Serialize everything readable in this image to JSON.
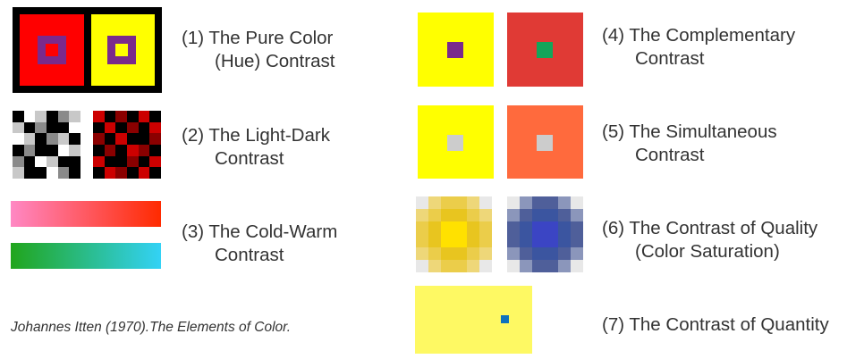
{
  "contrasts": [
    {
      "line1": "(1) The Pure Color",
      "line2": "(Hue) Contrast"
    },
    {
      "line1": "(2) The Light-Dark",
      "line2": "Contrast"
    },
    {
      "line1": "(3) The Cold-Warm",
      "line2": "Contrast"
    },
    {
      "line1": "(4) The Complementary",
      "line2": "Contrast"
    },
    {
      "line1": "(5) The Simultaneous",
      "line2": "Contrast"
    },
    {
      "line1": "(6) The Contrast of Quality",
      "line2": "(Color Saturation)"
    },
    {
      "line1": "(7) The Contrast of Quantity",
      "line2": ""
    }
  ],
  "caption": "Johannes Itten (1970).The Elements of Color.",
  "colors": {
    "black": "#000000",
    "red": "#ff0000",
    "yellow": "#ffff00",
    "purple": "#7a2a8c",
    "complementary_red": "#e03a35",
    "green": "#13a55a",
    "orange": "#ff6a3d",
    "gray": "#cccccc",
    "pink": "#ff88c4",
    "orange_red": "#ff2a00",
    "green_start": "#21a51c",
    "cyan": "#33d2f6",
    "pale_yellow": "#fef963",
    "blue_dot": "#0f72bd"
  },
  "checker_light_dark": [
    [
      0,
      1,
      3,
      0,
      2,
      3
    ],
    [
      3,
      0,
      2,
      0,
      0,
      1
    ],
    [
      1,
      3,
      0,
      2,
      3,
      0
    ],
    [
      0,
      2,
      0,
      0,
      1,
      3
    ],
    [
      2,
      0,
      1,
      3,
      0,
      0
    ],
    [
      3,
      0,
      0,
      1,
      2,
      0
    ]
  ],
  "checker_red_black": [
    [
      1,
      0,
      2,
      0,
      1,
      0
    ],
    [
      0,
      1,
      0,
      2,
      0,
      1
    ],
    [
      2,
      0,
      1,
      0,
      0,
      2
    ],
    [
      0,
      2,
      0,
      1,
      2,
      0
    ],
    [
      1,
      0,
      0,
      2,
      0,
      1
    ],
    [
      0,
      1,
      2,
      0,
      1,
      0
    ]
  ],
  "saturation_yellow": [
    [
      0,
      1,
      2,
      2,
      1,
      0
    ],
    [
      1,
      2,
      3,
      3,
      2,
      1
    ],
    [
      2,
      3,
      4,
      4,
      3,
      2
    ],
    [
      2,
      3,
      4,
      4,
      3,
      2
    ],
    [
      1,
      2,
      3,
      3,
      2,
      1
    ],
    [
      0,
      1,
      2,
      2,
      1,
      0
    ]
  ],
  "saturation_blue": [
    [
      0,
      1,
      2,
      2,
      1,
      0
    ],
    [
      1,
      2,
      3,
      3,
      2,
      1
    ],
    [
      2,
      3,
      4,
      4,
      3,
      2
    ],
    [
      2,
      3,
      4,
      4,
      3,
      2
    ],
    [
      1,
      2,
      3,
      3,
      2,
      1
    ],
    [
      0,
      1,
      2,
      2,
      1,
      0
    ]
  ]
}
